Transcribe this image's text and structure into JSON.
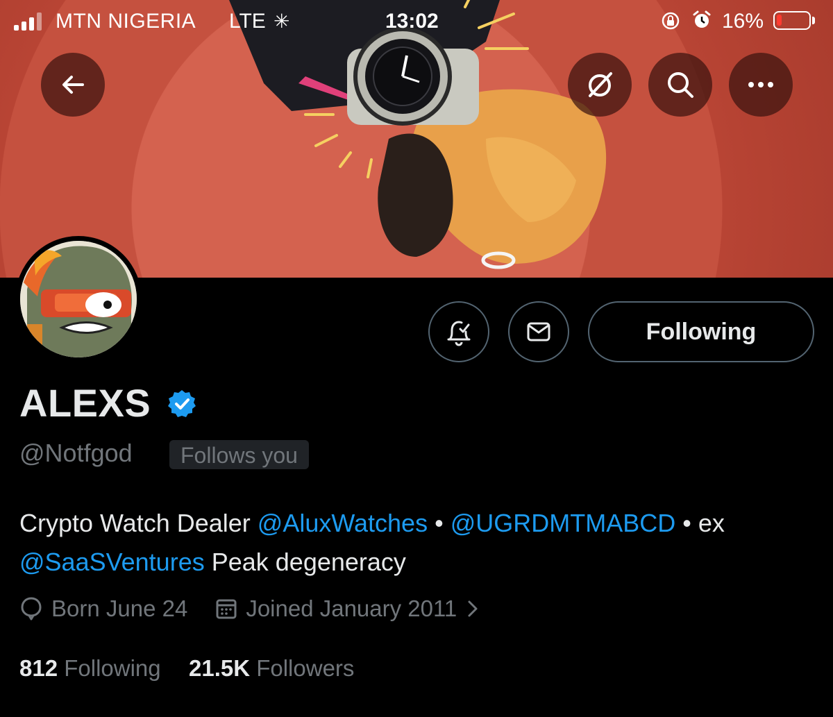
{
  "status_bar": {
    "carrier": "MTN NIGERIA",
    "network": "LTE",
    "time": "13:02",
    "battery_percent": "16%",
    "battery_level": 0.16
  },
  "profile": {
    "name": "ALEXS",
    "handle": "@Notfgod",
    "follows_you": "Follows you",
    "following_button": "Following",
    "bio": {
      "text1": "Crypto Watch Dealer ",
      "mention1": "@AluxWatches",
      "sep1": " • ",
      "mention2": "@UGRDMTMABCD",
      "sep2": " • ex ",
      "mention3": "@SaaSVentures",
      "text2": " Peak degeneracy"
    },
    "birthday": "Born June 24",
    "joined": "Joined January 2011",
    "following_count": "812",
    "following_label": " Following",
    "followers_count": "21.5K",
    "followers_label": " Followers"
  },
  "icons": {
    "back": "arrow-left-icon",
    "grok": "grok-icon",
    "search": "search-icon",
    "more": "more-icon",
    "notifications": "bell-check-icon",
    "message": "envelope-icon",
    "birthday": "balloon-icon",
    "calendar": "calendar-icon",
    "verified": "verified-badge-icon"
  },
  "colors": {
    "accent": "#1d9bf0",
    "muted": "#71767b",
    "battery_low": "#ff3b30"
  }
}
